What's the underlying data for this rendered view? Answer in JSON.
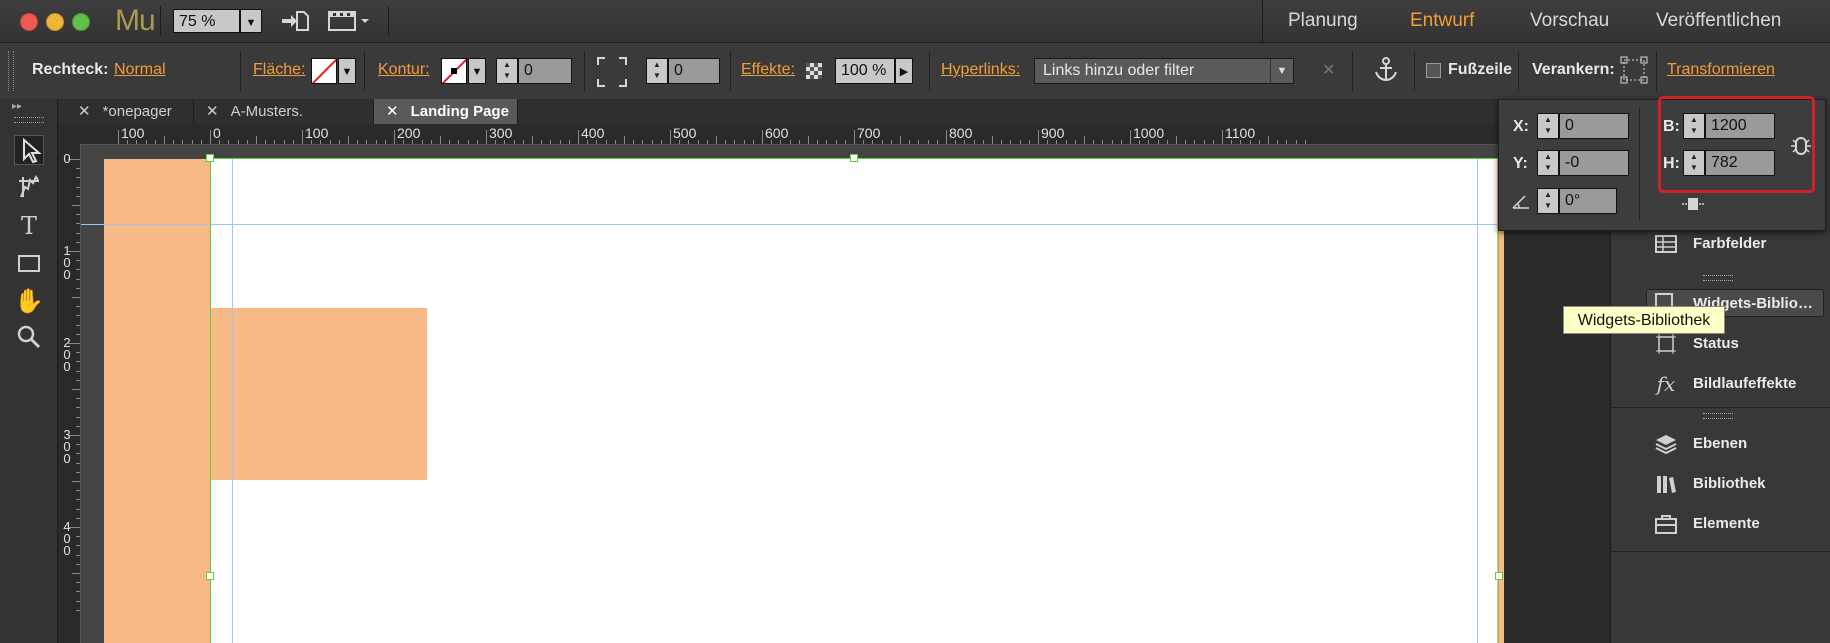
{
  "app": {
    "logo": "Mu",
    "zoom": "75 %",
    "modes": [
      "Planung",
      "Entwurf",
      "Vorschau",
      "Veröffentlichen"
    ],
    "active_mode": "Entwurf"
  },
  "controlbar": {
    "object_label": "Rechteck:",
    "object_style": "Normal",
    "fill_label": "Fläche:",
    "stroke_label": "Kontur:",
    "stroke_width": "0",
    "corner_radius": "0",
    "effects_label": "Effekte:",
    "opacity": "100 %",
    "hyperlinks_label": "Hyperlinks:",
    "hyperlinks_placeholder": "Links hinzu oder filter",
    "footer_label": "Fußzeile",
    "anchor_label": "Verankern:",
    "transform_link": "Transformieren"
  },
  "doc_tabs": [
    {
      "label": "*onepager"
    },
    {
      "label": "A-Musters."
    },
    {
      "label": "Landing Page"
    }
  ],
  "ruler": {
    "h_labels": [
      "100",
      "0",
      "100",
      "200",
      "300",
      "400",
      "500",
      "600",
      "700",
      "800",
      "900",
      "1000",
      "1100"
    ],
    "v_labels": [
      "0",
      "100",
      "200",
      "300",
      "400"
    ]
  },
  "transform_panel": {
    "x_label": "X:",
    "x_value": "0",
    "y_label": "Y:",
    "y_value": "-0",
    "rotation_value": "0°",
    "w_label": "B:",
    "w_value": "1200",
    "h_label": "H:",
    "h_value": "782"
  },
  "right_panel": {
    "items": [
      {
        "label": "Farbfelder",
        "icon": "grid-icon"
      },
      {
        "label": "Widgets-Biblio…",
        "icon": "widgets-icon"
      },
      {
        "label": "Status",
        "icon": "state-icon"
      },
      {
        "label": "Bildlaufeffekte",
        "icon": "fx-icon"
      },
      {
        "label": "Ebenen",
        "icon": "layers-icon"
      },
      {
        "label": "Bibliothek",
        "icon": "library-icon"
      },
      {
        "label": "Elemente",
        "icon": "assets-icon"
      }
    ]
  },
  "tooltip": "Widgets-Bibliothek",
  "colors": {
    "accent": "#f29d3b",
    "shape_fill": "#f7b986",
    "highlight": "#d21f2a",
    "guide": "#9ec6f5",
    "selection": "#5fcf3c"
  }
}
